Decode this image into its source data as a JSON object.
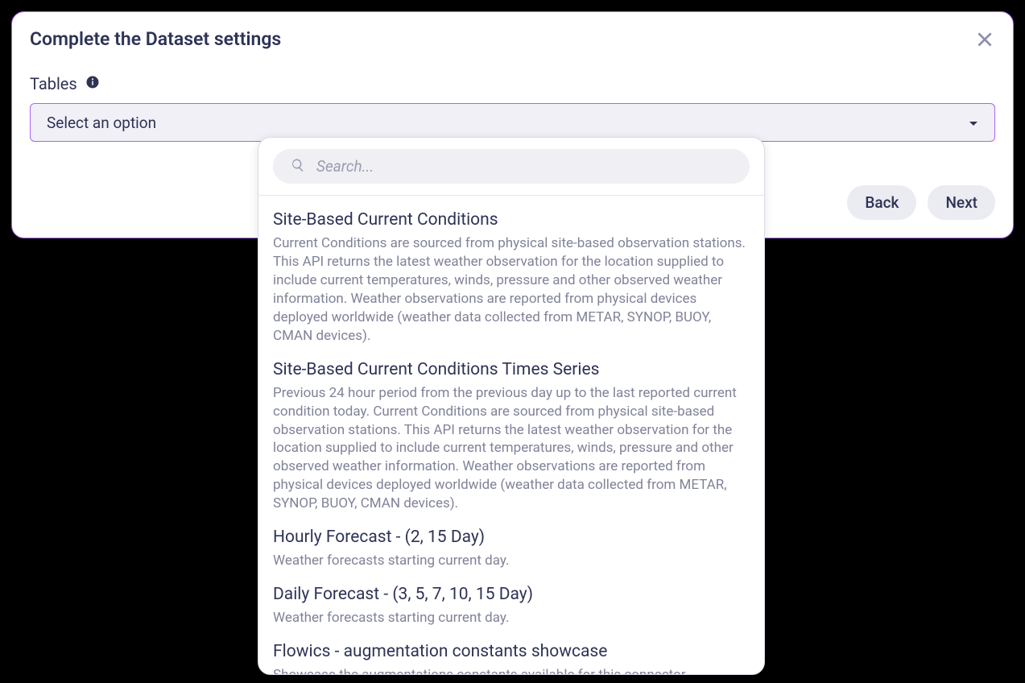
{
  "modal": {
    "title": "Complete the Dataset settings",
    "field_label": "Tables",
    "select_placeholder": "Select an option",
    "back_label": "Back",
    "next_label": "Next"
  },
  "dropdown": {
    "search_placeholder": "Search...",
    "options": [
      {
        "title": "Site-Based Current Conditions",
        "desc": "Current Conditions are sourced from physical site-based observation stations. This API returns the latest weather observation for the location supplied to include current temperatures, winds, pressure and other observed weather information. Weather observations are reported from physical devices deployed worldwide (weather data collected from METAR, SYNOP, BUOY, CMAN devices)."
      },
      {
        "title": "Site-Based Current Conditions Times Series",
        "desc": "Previous 24 hour period from the previous day up to the last reported current condition today. Current Conditions are sourced from physical site-based observation stations. This API returns the latest weather observation for the location supplied to include current temperatures, winds, pressure and other observed weather information. Weather observations are reported from physical devices deployed worldwide (weather data collected from METAR, SYNOP, BUOY, CMAN devices)."
      },
      {
        "title": "Hourly Forecast - (2, 15 Day)",
        "desc": "Weather forecasts starting current day."
      },
      {
        "title": "Daily Forecast - (3, 5, 7, 10, 15 Day)",
        "desc": "Weather forecasts starting current day."
      },
      {
        "title": "Flowics - augmentation constants showcase",
        "desc": "Showcase the augmentations constants available for this connector."
      }
    ]
  }
}
